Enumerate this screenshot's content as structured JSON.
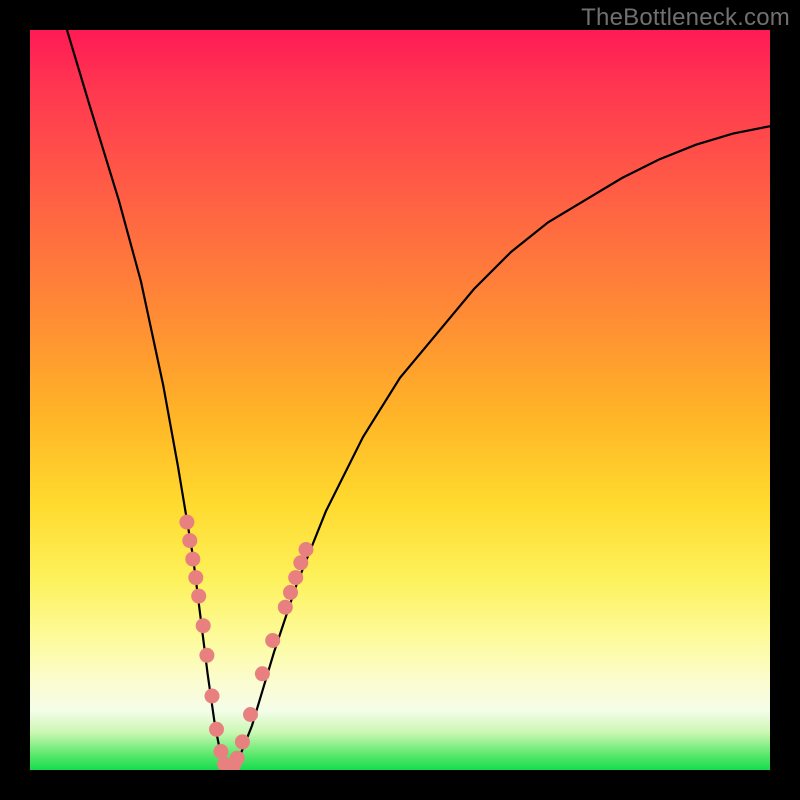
{
  "watermark": "TheBottleneck.com",
  "chart_data": {
    "type": "line",
    "title": "",
    "xlabel": "",
    "ylabel": "",
    "xlim": [
      0,
      100
    ],
    "ylim": [
      0,
      100
    ],
    "grid": false,
    "legend": false,
    "series": [
      {
        "name": "bottleneck-curve",
        "x": [
          5,
          8,
          12,
          15,
          18,
          20,
          22,
          23,
          24,
          25,
          26,
          27,
          28,
          30,
          33,
          36,
          40,
          45,
          50,
          55,
          60,
          65,
          70,
          75,
          80,
          85,
          90,
          95,
          100
        ],
        "y": [
          100,
          90,
          77,
          66,
          52,
          41,
          29,
          21,
          13,
          6,
          1,
          0,
          1,
          6,
          16,
          25,
          35,
          45,
          53,
          59,
          65,
          70,
          74,
          77,
          80,
          82.5,
          84.5,
          86,
          87
        ]
      }
    ],
    "markers": [
      {
        "x": 21.2,
        "y": 33.5
      },
      {
        "x": 21.6,
        "y": 31.0
      },
      {
        "x": 22.0,
        "y": 28.5
      },
      {
        "x": 22.4,
        "y": 26.0
      },
      {
        "x": 22.8,
        "y": 23.5
      },
      {
        "x": 23.4,
        "y": 19.5
      },
      {
        "x": 23.9,
        "y": 15.5
      },
      {
        "x": 24.6,
        "y": 10.0
      },
      {
        "x": 25.2,
        "y": 5.5
      },
      {
        "x": 25.8,
        "y": 2.5
      },
      {
        "x": 26.3,
        "y": 0.8
      },
      {
        "x": 26.7,
        "y": 0.2
      },
      {
        "x": 27.1,
        "y": 0.2
      },
      {
        "x": 27.5,
        "y": 0.6
      },
      {
        "x": 28.0,
        "y": 1.6
      },
      {
        "x": 28.7,
        "y": 3.8
      },
      {
        "x": 29.8,
        "y": 7.5
      },
      {
        "x": 31.4,
        "y": 13.0
      },
      {
        "x": 32.8,
        "y": 17.5
      },
      {
        "x": 34.5,
        "y": 22.0
      },
      {
        "x": 35.2,
        "y": 24.0
      },
      {
        "x": 35.9,
        "y": 26.0
      },
      {
        "x": 36.6,
        "y": 28.0
      },
      {
        "x": 37.3,
        "y": 29.8
      }
    ],
    "gradient_stops": [
      {
        "pos": 0,
        "color": "#ff1a55"
      },
      {
        "pos": 22,
        "color": "#ff5e45"
      },
      {
        "pos": 52,
        "color": "#ffb427"
      },
      {
        "pos": 74,
        "color": "#fdf15a"
      },
      {
        "pos": 92,
        "color": "#f4fde8"
      },
      {
        "pos": 100,
        "color": "#16dc4e"
      }
    ],
    "marker_color": "#e88080",
    "curve_color": "#000000"
  }
}
